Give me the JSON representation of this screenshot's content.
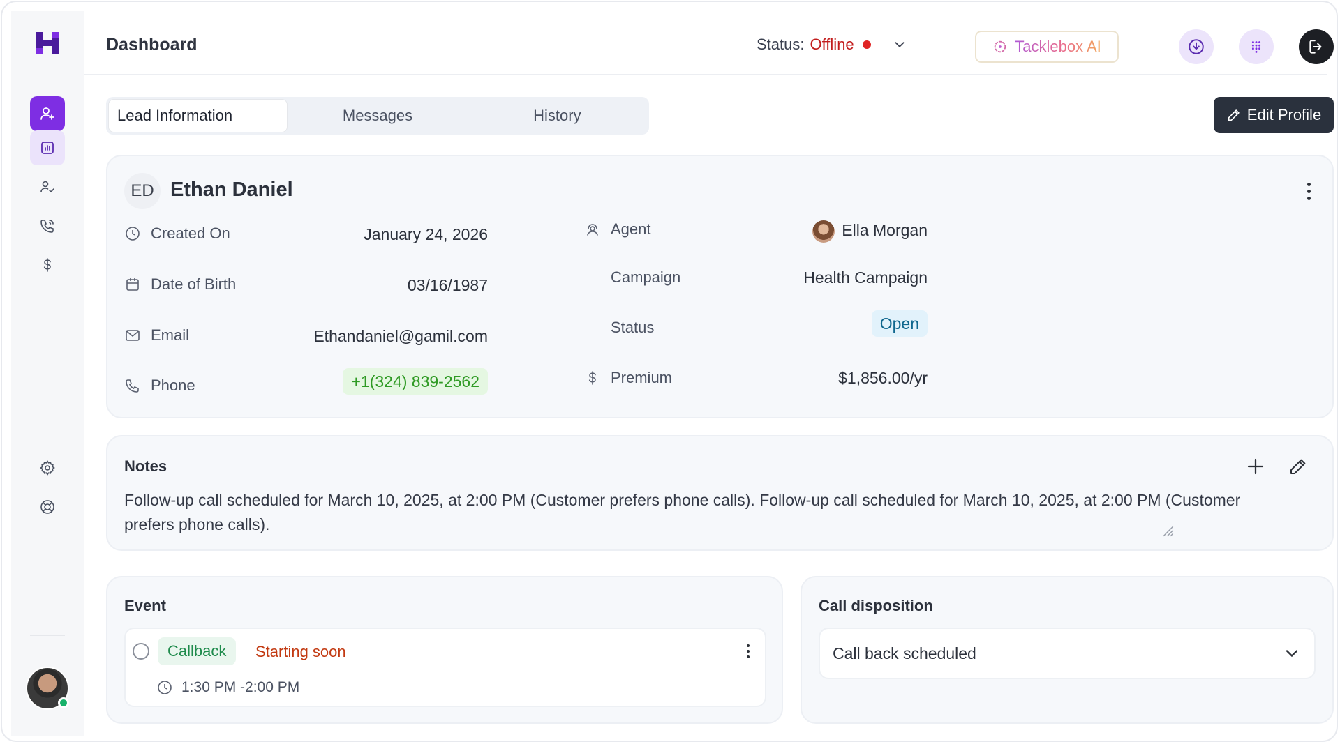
{
  "header": {
    "title": "Dashboard",
    "status_label": "Status:",
    "status_value": "Offline",
    "ai_button": "Tacklebox AI"
  },
  "tabs": [
    {
      "label": "Lead Information"
    },
    {
      "label": "Messages"
    },
    {
      "label": "History"
    }
  ],
  "edit_profile_label": "Edit Profile",
  "lead": {
    "initials": "ED",
    "name": "Ethan Daniel",
    "created_on_label": "Created On",
    "created_on": "January 24, 2026",
    "dob_label": "Date of Birth",
    "dob": "03/16/1987",
    "email_label": "Email",
    "email": "Ethandaniel@gamil.com",
    "phone_label": "Phone",
    "phone": "+1(324) 839-2562",
    "agent_label": "Agent",
    "agent": "Ella Morgan",
    "campaign_label": "Campaign",
    "campaign": "Health Campaign",
    "status_label": "Status",
    "status": "Open",
    "premium_label": "Premium",
    "premium": "$1,856.00/yr"
  },
  "notes": {
    "title": "Notes",
    "text": "Follow-up call scheduled for March 10, 2025, at 2:00 PM (Customer prefers phone calls). Follow-up call scheduled for March 10, 2025, at 2:00 PM (Customer prefers phone calls)."
  },
  "event": {
    "title": "Event",
    "type": "Callback",
    "state": "Starting soon",
    "time": "1:30 PM -2:00 PM"
  },
  "disposition": {
    "title": "Call disposition",
    "selected": "Call back scheduled"
  },
  "colors": {
    "accent": "#7e2ee3",
    "offline": "#c21d1d",
    "phone_bg": "#e5f7e2",
    "open_bg": "#e2f2fb"
  }
}
